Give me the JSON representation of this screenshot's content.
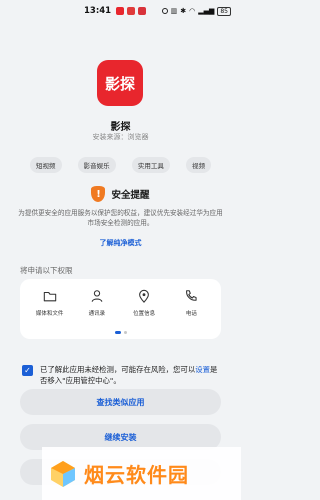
{
  "status_bar": {
    "time": "13:41",
    "battery": "85"
  },
  "app": {
    "icon_text": "影探",
    "name": "影探",
    "source": "安装来源：浏览器",
    "icon_color": "#e8262d"
  },
  "tags": [
    "短视频",
    "影音娱乐",
    "实用工具",
    "视频"
  ],
  "security": {
    "icon": "shield-warning-icon",
    "icon_glyph": "!",
    "title": "安全提醒",
    "description": "为提供更安全的应用服务以保护您的权益，建议优先安装经过华为应用市场安全检测的应用。",
    "link": "了解纯净模式",
    "accent": "#f07a22"
  },
  "permissions": {
    "title": "将申请以下权限",
    "items": [
      {
        "label": "媒体和文件",
        "icon": "folder-icon"
      },
      {
        "label": "通讯录",
        "icon": "contacts-icon"
      },
      {
        "label": "位置信息",
        "icon": "location-icon"
      },
      {
        "label": "电话",
        "icon": "phone-icon"
      }
    ]
  },
  "agreement": {
    "checked": true,
    "checkmark": "✓",
    "text_before": "已了解此应用未经检测，可能存在风险，您可以",
    "link": "设置",
    "text_after": "是否移入\"应用管控中心\"。"
  },
  "buttons": {
    "find_similar": "查找类似应用",
    "continue_install": "继续安装"
  },
  "watermark": {
    "text": "烟云软件园"
  },
  "colors": {
    "accent": "#1b5fd6",
    "background": "#f1f3f5"
  }
}
